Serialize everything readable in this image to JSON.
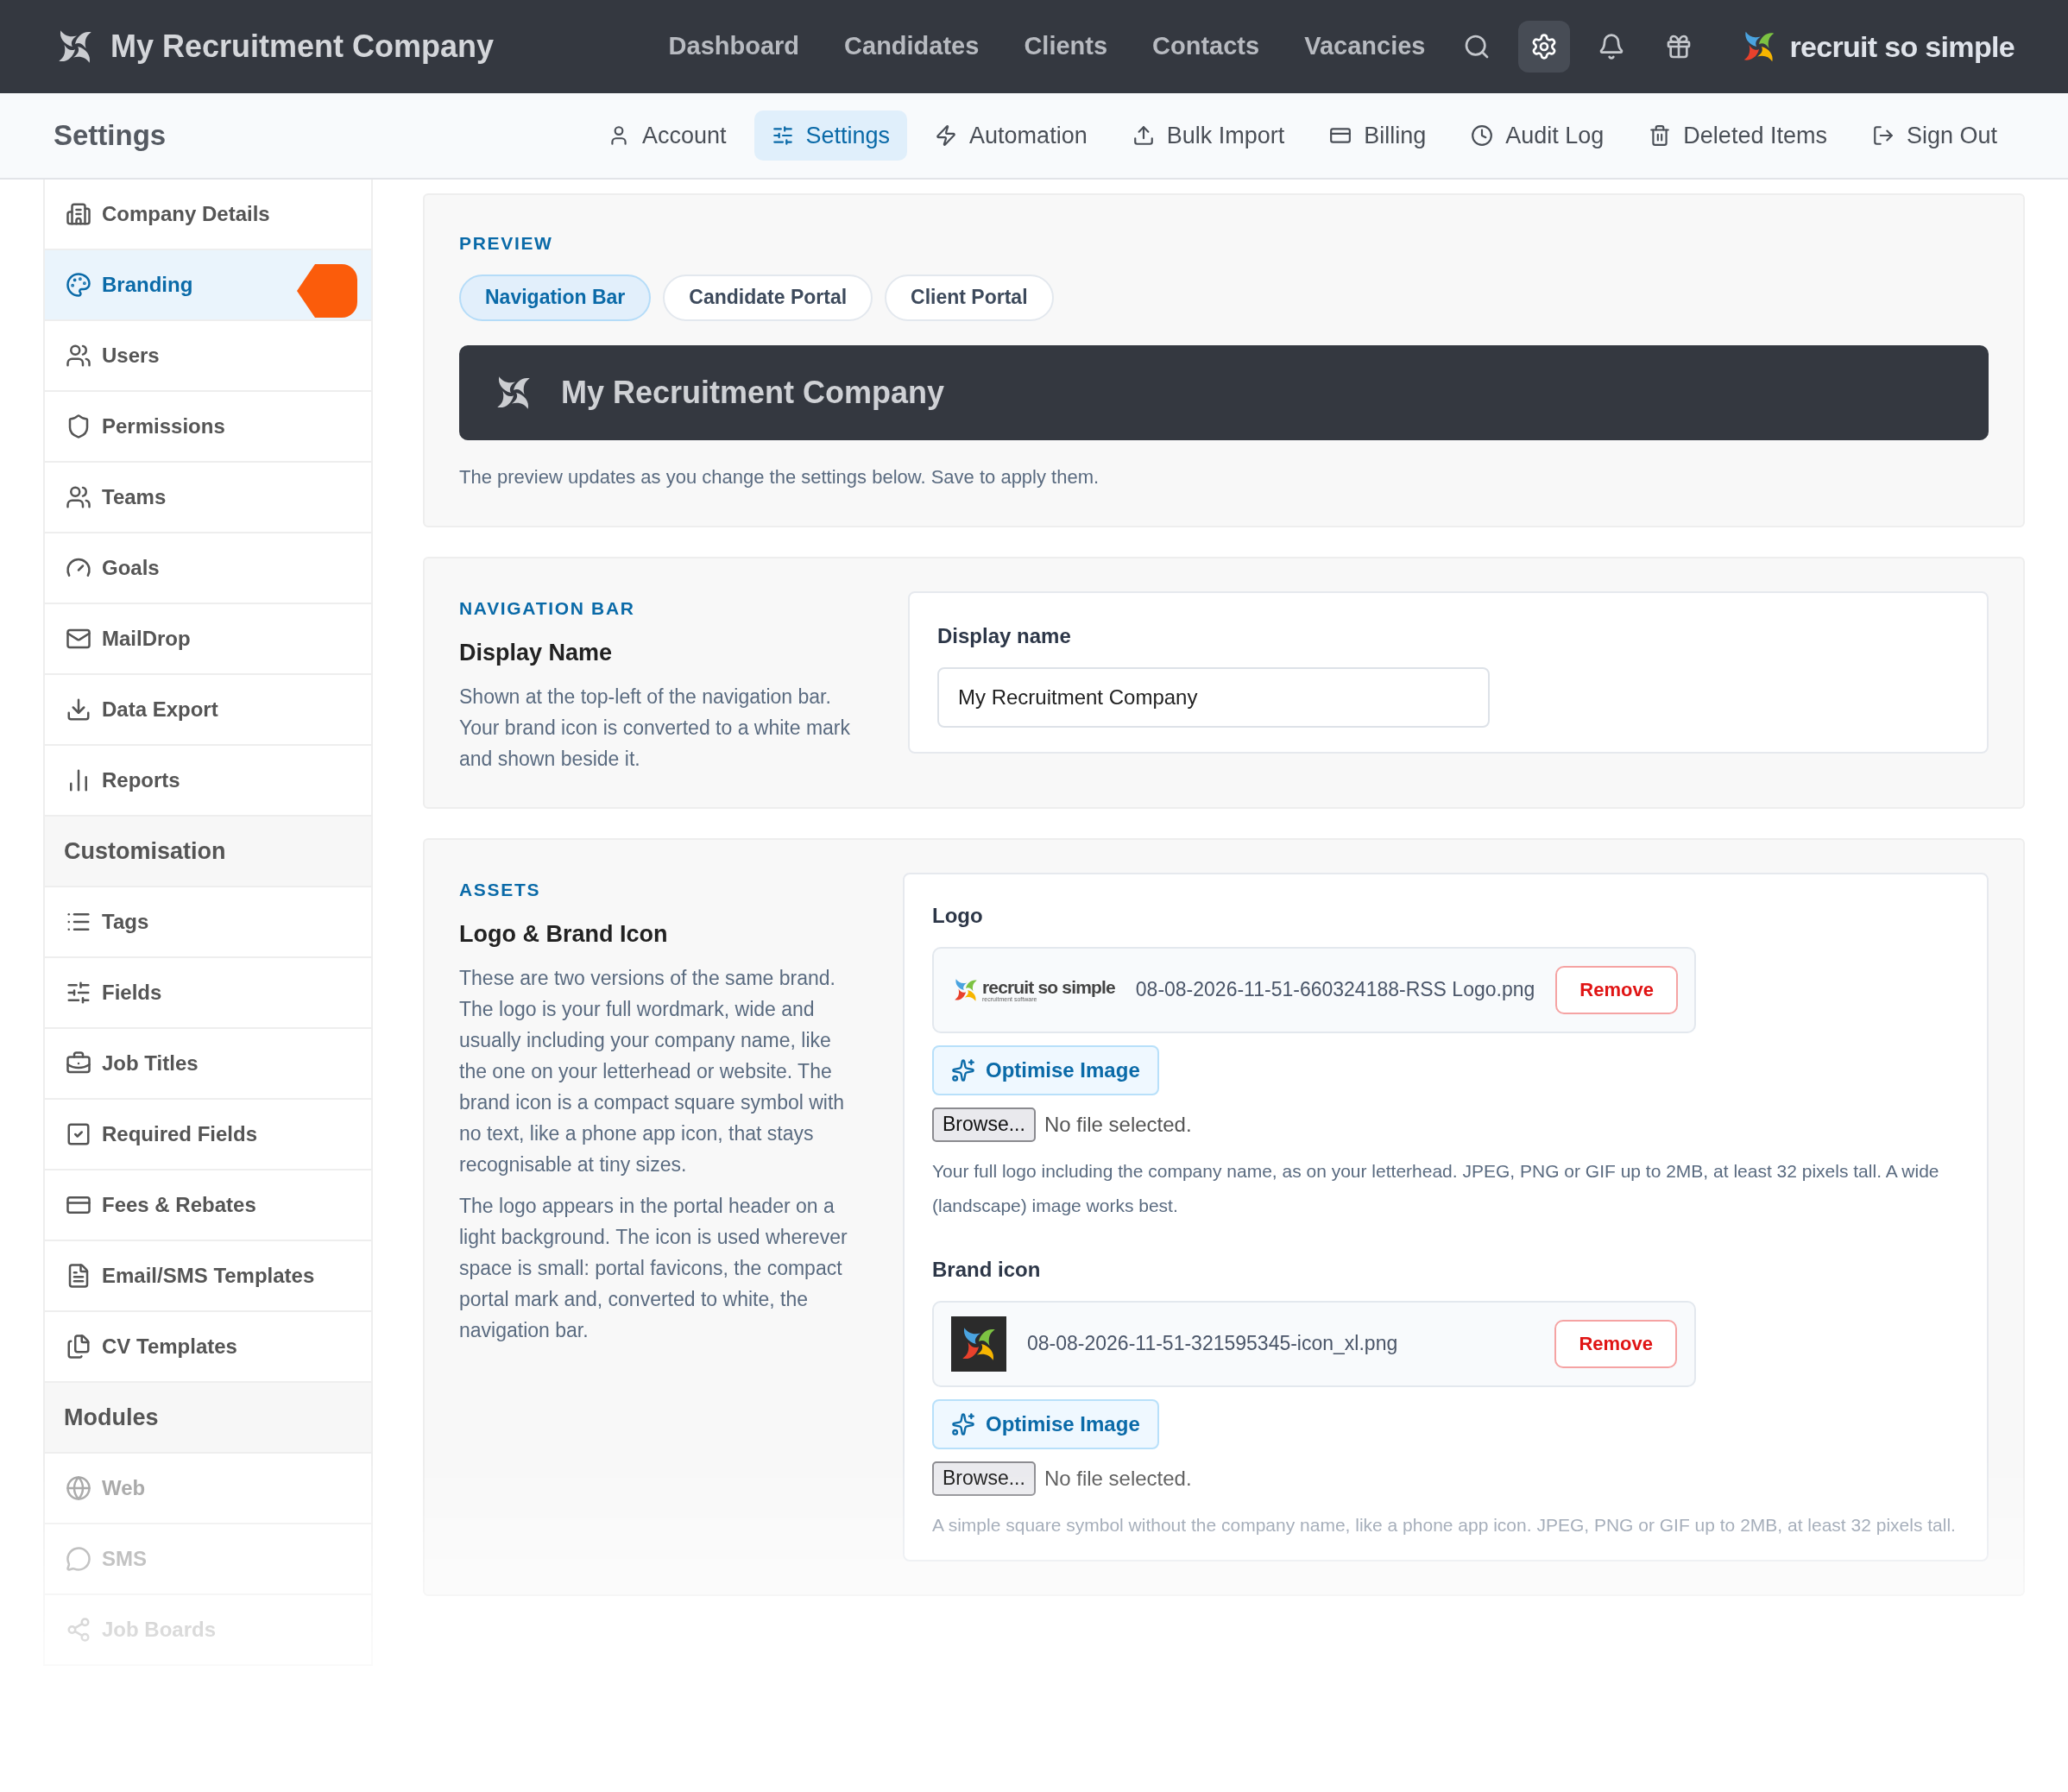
{
  "top_nav": {
    "company_name": "My Recruitment Company",
    "links": [
      {
        "label": "Dashboard",
        "selected": false
      },
      {
        "label": "Candidates",
        "selected": false
      },
      {
        "label": "Clients",
        "selected": false
      },
      {
        "label": "Contacts",
        "selected": false
      },
      {
        "label": "Vacancies",
        "selected": false
      }
    ],
    "icon_buttons": [
      {
        "selected": false
      },
      {
        "selected": true
      },
      {
        "selected": false
      },
      {
        "selected": false
      }
    ],
    "brand": "recruit so simple"
  },
  "page_header": {
    "title": "Settings",
    "tabs": [
      {
        "label": "Account",
        "selected": false
      },
      {
        "label": "Settings",
        "selected": true
      },
      {
        "label": "Automation",
        "selected": false
      },
      {
        "label": "Bulk Import",
        "selected": false
      },
      {
        "label": "Billing",
        "selected": false
      },
      {
        "label": "Audit Log",
        "selected": false
      },
      {
        "label": "Deleted Items",
        "selected": false
      },
      {
        "label": "Sign Out",
        "selected": false
      }
    ]
  },
  "sidebar": {
    "sections": [
      {
        "items": [
          {
            "label": "Company Details",
            "selected": false,
            "disabled": false
          },
          {
            "label": "Branding",
            "selected": true,
            "disabled": false
          },
          {
            "label": "Users",
            "selected": false,
            "disabled": false
          },
          {
            "label": "Permissions",
            "selected": false,
            "disabled": false
          },
          {
            "label": "Teams",
            "selected": false,
            "disabled": false
          },
          {
            "label": "Goals",
            "selected": false,
            "disabled": false
          },
          {
            "label": "MailDrop",
            "selected": false,
            "disabled": false
          },
          {
            "label": "Data Export",
            "selected": false,
            "disabled": false
          },
          {
            "label": "Reports",
            "selected": false,
            "disabled": false
          }
        ]
      },
      {
        "heading": "Customisation",
        "items": [
          {
            "label": "Tags",
            "selected": false,
            "disabled": false
          },
          {
            "label": "Fields",
            "selected": false,
            "disabled": false
          },
          {
            "label": "Job Titles",
            "selected": false,
            "disabled": false
          },
          {
            "label": "Required Fields",
            "selected": false,
            "disabled": false
          },
          {
            "label": "Fees & Rebates",
            "selected": false,
            "disabled": false
          },
          {
            "label": "Email/SMS Templates",
            "selected": false,
            "disabled": false
          },
          {
            "label": "CV Templates",
            "selected": false,
            "disabled": false
          }
        ]
      },
      {
        "heading": "Modules",
        "items": [
          {
            "label": "Web",
            "selected": false,
            "disabled": true
          },
          {
            "label": "SMS",
            "selected": false,
            "disabled": true
          },
          {
            "label": "Job Boards",
            "selected": false,
            "disabled": true
          }
        ]
      }
    ]
  },
  "preview": {
    "heading": "PREVIEW",
    "tabs": [
      {
        "label": "Navigation Bar",
        "selected": true
      },
      {
        "label": "Candidate Portal",
        "selected": false
      },
      {
        "label": "Client Portal",
        "selected": false
      }
    ],
    "nav_bar_name": "My Recruitment Company",
    "note": "The preview updates as you change the settings below. Save to apply them."
  },
  "navigation_bar": {
    "heading": "NAVIGATION BAR",
    "title": "Display Name",
    "description": "Shown at the top-left of the navigation bar. Your brand icon is converted to a white mark and shown beside it.",
    "field": {
      "label": "Display name",
      "value": "My Recruitment Company"
    }
  },
  "assets": {
    "heading": "ASSETS",
    "title": "Logo & Brand Icon",
    "paragraphs": [
      "These are two versions of the same brand. The logo is your full wordmark, wide and usually including your company name, like the one on your letterhead or website. The brand icon is a compact square symbol with no text, like a phone app icon, that stays recognisable at tiny sizes.",
      "The logo appears in the portal header on a light background. The icon is used wherever space is small: portal favicons, the compact portal mark and, converted to white, the navigation bar."
    ],
    "uploads": [
      {
        "kind": "wordmark",
        "label": "Logo",
        "thumbnail_text": "recruit so simple",
        "thumbnail_tagline": "recruitment software",
        "file_name": "08-08-2026-11-51-660324188-RSS Logo.png",
        "remove": "Remove",
        "optimise": "Optimise Image",
        "browse": "Browse...",
        "file_status": "No file selected.",
        "hint": "Your full logo including the company name, as on your letterhead. JPEG, PNG or GIF up to 2MB, at least 32 pixels tall. A wide (landscape) image works best."
      },
      {
        "kind": "icon",
        "label": "Brand icon",
        "file_name": "08-08-2026-11-51-321595345-icon_xl.png",
        "remove": "Remove",
        "optimise": "Optimise Image",
        "browse": "Browse...",
        "file_status": "No file selected.",
        "hint": "A simple square symbol without the company name, like a phone app icon. JPEG, PNG or GIF up to 2MB, at least 32 pixels tall."
      }
    ]
  }
}
